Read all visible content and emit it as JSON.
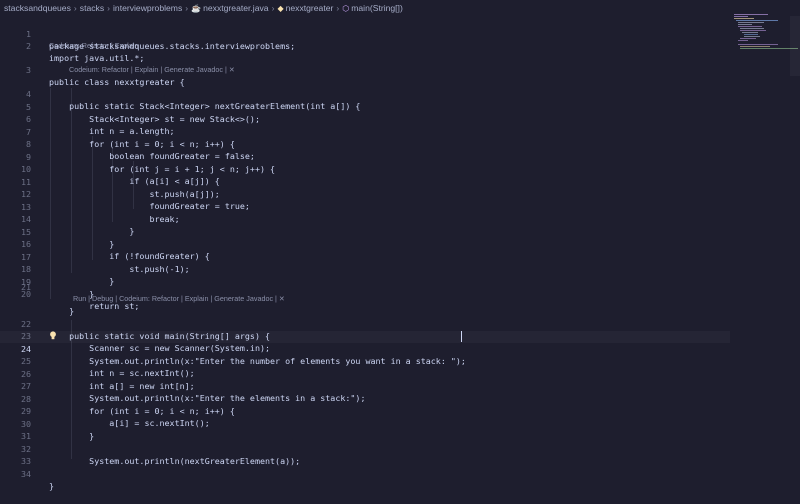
{
  "breadcrumb": {
    "items": [
      "stacksandqueues",
      "stacks",
      "interviewproblems",
      "nexxtgreater.java",
      "nexxtgreater",
      "main(String[])"
    ]
  },
  "code_lenses": {
    "above_line_3": "Codeium: Refactor | Explain",
    "above_line_4": "Codeium: Refactor | Explain | Generate Javadoc | ✕",
    "above_line_22": "Run | Debug | Codeium: Refactor | Explain | Generate Javadoc | ✕"
  },
  "editor": {
    "active_line": 24,
    "lines": [
      "package stacksandqueues.stacks.interviewproblems;",
      "import java.util.*;",
      "public class nexxtgreater {",
      "    public static Stack<Integer> nextGreaterElement(int a[]) {",
      "        Stack<Integer> st = new Stack<>();",
      "        int n = a.length;",
      "        for (int i = 0; i < n; i++) {",
      "            boolean foundGreater = false;",
      "            for (int j = i + 1; j < n; j++) {",
      "                if (a[i] < a[j]) {",
      "                    st.push(a[j]);",
      "                    foundGreater = true;",
      "                    break;",
      "                }",
      "            }",
      "            if (!foundGreater) {",
      "                st.push(-1);",
      "            }",
      "        }",
      "        return st;",
      "    }",
      "    public static void main(String[] args) {",
      "        Scanner sc = new Scanner(System.in);",
      "        System.out.println(x:\"Enter the number of elements you want in a stack: \");",
      "        int n = sc.nextInt();",
      "        int a[] = new int[n];",
      "        System.out.println(x:\"Enter the elements in a stack:\");",
      "        for (int i = 0; i < n; i++) {",
      "            a[i] = sc.nextInt();",
      "        }",
      "",
      "        System.out.println(nextGreaterElement(a));",
      "",
      "}"
    ]
  },
  "colors": {
    "background": "#1e1e2e",
    "keyword": "#cba6f7",
    "type": "#f9e2af",
    "function": "#89b4fa",
    "string": "#a6e3a1",
    "number": "#fab387",
    "operator": "#89dceb"
  },
  "icons": {
    "breadcrumb_separator": "chevron-right-icon",
    "file": "java-file-icon",
    "class": "class-icon",
    "method": "method-icon",
    "line_24": "lightbulb-icon"
  }
}
